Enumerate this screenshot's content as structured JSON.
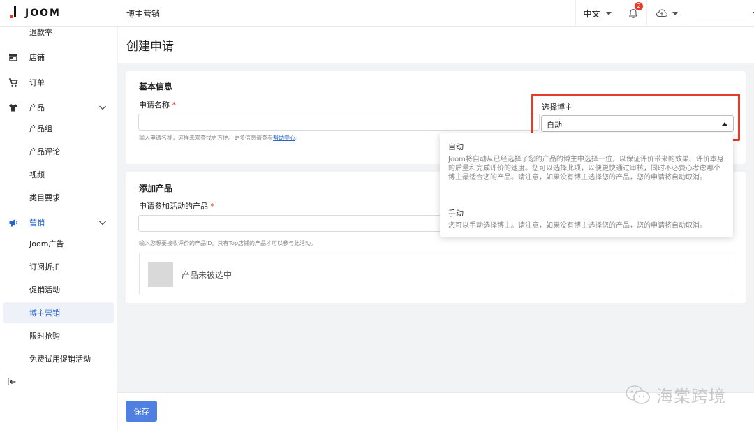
{
  "brand": {
    "name": "JOOM"
  },
  "header": {
    "section_title": "博主营销",
    "language": "中文",
    "notifications_count": "2"
  },
  "sidebar": {
    "items": [
      {
        "label": "退款率",
        "icon": ""
      },
      {
        "label": "店铺",
        "icon": "store-icon"
      },
      {
        "label": "订单",
        "icon": "cart-icon"
      },
      {
        "label": "产品",
        "icon": "shirt-icon",
        "expandable": true
      },
      {
        "label": "产品组"
      },
      {
        "label": "产品评论"
      },
      {
        "label": "视频"
      },
      {
        "label": "类目要求"
      },
      {
        "label": "营销",
        "icon": "megaphone-icon",
        "expandable": true
      },
      {
        "label": "Joom广告"
      },
      {
        "label": "订阅折扣"
      },
      {
        "label": "促销活动"
      },
      {
        "label": "博主营销",
        "active": true
      },
      {
        "label": "限时抢购"
      },
      {
        "label": "免费试用促销活动"
      }
    ]
  },
  "page": {
    "title": "创建申请",
    "basic_info": {
      "title": "基本信息",
      "name_label": "申请名称",
      "required_mark": "*",
      "name_value": "",
      "name_hint": "输入申请名称，这样未来查找更方便。更多信息请查看",
      "name_hint_link": "帮助中心",
      "name_hint_end": "。",
      "blogger_label": "选择博主",
      "blogger_value": "自动"
    },
    "products": {
      "title": "添加产品",
      "field_label": "申请参加活动的产品",
      "required_mark": "*",
      "hint": "输入您想要接收评价的产品ID。只有Top店铺的产品才可以参与此活动。",
      "empty_text": "产品未被选中"
    },
    "dropdown": {
      "options": [
        {
          "title": "自动",
          "desc": "Joom将自动从已经选择了您的产品的博主中选择一位，以保证评价带来的效果、评价本身的质量和完成评价的速度。您可以选择此项，以便更快通过审核，同时不必费心考虑哪个博主最适合您的产品。请注意，如果没有博主选择您的产品，您的申请将自动取消。"
        },
        {
          "title": "手动",
          "desc": "您可以手动选择博主。请注意，如果没有博主选择您的产品，您的申请将自动取消。"
        }
      ]
    },
    "save_label": "保存"
  },
  "watermark": {
    "text": "海棠跨境"
  },
  "colors": {
    "accent": "#4f7fe0",
    "highlight": "#e83a2a",
    "badge": "#e53a2f"
  }
}
